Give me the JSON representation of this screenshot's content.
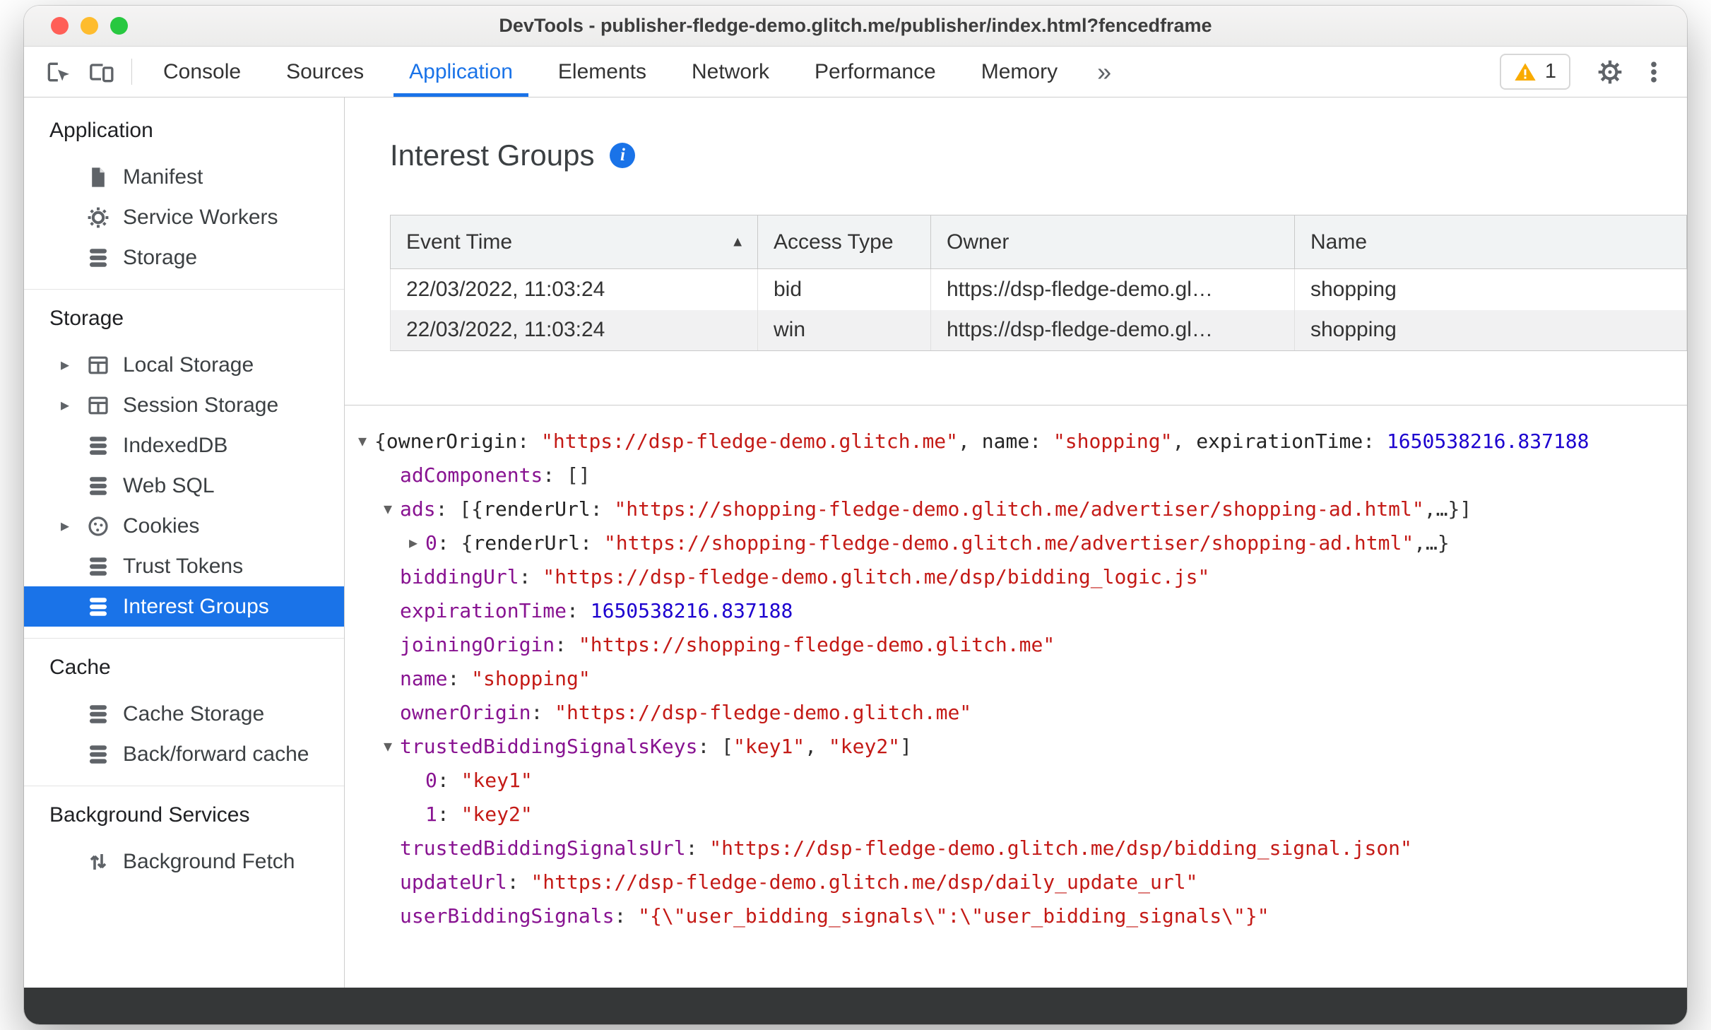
{
  "colors": {
    "accent": "#1a73e8",
    "key_purple": "#881391",
    "string_red": "#c41a16",
    "number_blue": "#1c00cf",
    "warning_yellow": "#f9ab00",
    "selected_bg": "#1a73e8"
  },
  "window": {
    "title": "DevTools - publisher-fledge-demo.glitch.me/publisher/index.html?fencedframe"
  },
  "toolbar": {
    "left_icons": [
      "inspect-icon",
      "device-toolbar-icon"
    ],
    "tabs": [
      "Console",
      "Sources",
      "Application",
      "Elements",
      "Network",
      "Performance",
      "Memory"
    ],
    "active_tab": "Application",
    "overflow_icon": "»",
    "warning_count": "1",
    "right_icons": [
      "settings-gear-icon",
      "more-options-icon"
    ]
  },
  "sidebar": {
    "sections": [
      {
        "title": "Application",
        "items": [
          {
            "label": "Manifest",
            "icon": "manifest-icon"
          },
          {
            "label": "Service Workers",
            "icon": "service-worker-icon"
          },
          {
            "label": "Storage",
            "icon": "database-icon"
          }
        ]
      },
      {
        "title": "Storage",
        "items": [
          {
            "label": "Local Storage",
            "icon": "table-icon",
            "expandable": true
          },
          {
            "label": "Session Storage",
            "icon": "table-icon",
            "expandable": true
          },
          {
            "label": "IndexedDB",
            "icon": "database-icon"
          },
          {
            "label": "Web SQL",
            "icon": "database-icon"
          },
          {
            "label": "Cookies",
            "icon": "cookie-icon",
            "expandable": true
          },
          {
            "label": "Trust Tokens",
            "icon": "database-icon"
          },
          {
            "label": "Interest Groups",
            "icon": "database-icon",
            "selected": true
          }
        ]
      },
      {
        "title": "Cache",
        "items": [
          {
            "label": "Cache Storage",
            "icon": "database-icon"
          },
          {
            "label": "Back/forward cache",
            "icon": "database-icon"
          }
        ]
      },
      {
        "title": "Background Services",
        "items": [
          {
            "label": "Background Fetch",
            "icon": "background-fetch-icon"
          }
        ]
      }
    ]
  },
  "main": {
    "title": "Interest Groups",
    "info_icon": "i",
    "table": {
      "columns": [
        "Event Time",
        "Access Type",
        "Owner",
        "Name"
      ],
      "sorted_column": "Event Time",
      "sort_direction": "asc",
      "rows": [
        [
          "22/03/2022, 11:03:24",
          "bid",
          "https://dsp-fledge-demo.gl…",
          "shopping"
        ],
        [
          "22/03/2022, 11:03:24",
          "win",
          "https://dsp-fledge-demo.gl…",
          "shopping"
        ]
      ]
    },
    "tree": {
      "lines": [
        {
          "indent": 0,
          "arrow": "down",
          "segments": [
            {
              "t": "plain",
              "x": "{"
            },
            {
              "t": "pkey",
              "x": "ownerOrigin"
            },
            {
              "t": "plain",
              "x": ": "
            },
            {
              "t": "str",
              "x": "\"https://dsp-fledge-demo.glitch.me\""
            },
            {
              "t": "plain",
              "x": ", "
            },
            {
              "t": "pkey",
              "x": "name"
            },
            {
              "t": "plain",
              "x": ": "
            },
            {
              "t": "str",
              "x": "\"shopping\""
            },
            {
              "t": "plain",
              "x": ", "
            },
            {
              "t": "pkey",
              "x": "expirationTime"
            },
            {
              "t": "plain",
              "x": ": "
            },
            {
              "t": "num",
              "x": "1650538216.837188"
            }
          ]
        },
        {
          "indent": 1,
          "arrow": "none",
          "segments": [
            {
              "t": "key",
              "x": "adComponents"
            },
            {
              "t": "plain",
              "x": ": "
            },
            {
              "t": "plain",
              "x": "[]"
            }
          ]
        },
        {
          "indent": 1,
          "arrow": "down",
          "segments": [
            {
              "t": "key",
              "x": "ads"
            },
            {
              "t": "plain",
              "x": ": "
            },
            {
              "t": "plain",
              "x": "[{"
            },
            {
              "t": "pkey",
              "x": "renderUrl"
            },
            {
              "t": "plain",
              "x": ": "
            },
            {
              "t": "str",
              "x": "\"https://shopping-fledge-demo.glitch.me/advertiser/shopping-ad.html\""
            },
            {
              "t": "plain",
              "x": ",…}]"
            }
          ]
        },
        {
          "indent": 2,
          "arrow": "right",
          "segments": [
            {
              "t": "index",
              "x": "0"
            },
            {
              "t": "plain",
              "x": ": {"
            },
            {
              "t": "pkey",
              "x": "renderUrl"
            },
            {
              "t": "plain",
              "x": ": "
            },
            {
              "t": "str",
              "x": "\"https://shopping-fledge-demo.glitch.me/advertiser/shopping-ad.html\""
            },
            {
              "t": "plain",
              "x": ",…}"
            }
          ]
        },
        {
          "indent": 1,
          "arrow": "none",
          "segments": [
            {
              "t": "key",
              "x": "biddingUrl"
            },
            {
              "t": "plain",
              "x": ": "
            },
            {
              "t": "str",
              "x": "\"https://dsp-fledge-demo.glitch.me/dsp/bidding_logic.js\""
            }
          ]
        },
        {
          "indent": 1,
          "arrow": "none",
          "segments": [
            {
              "t": "key",
              "x": "expirationTime"
            },
            {
              "t": "plain",
              "x": ": "
            },
            {
              "t": "num",
              "x": "1650538216.837188"
            }
          ]
        },
        {
          "indent": 1,
          "arrow": "none",
          "segments": [
            {
              "t": "key",
              "x": "joiningOrigin"
            },
            {
              "t": "plain",
              "x": ": "
            },
            {
              "t": "str",
              "x": "\"https://shopping-fledge-demo.glitch.me\""
            }
          ]
        },
        {
          "indent": 1,
          "arrow": "none",
          "segments": [
            {
              "t": "key",
              "x": "name"
            },
            {
              "t": "plain",
              "x": ": "
            },
            {
              "t": "str",
              "x": "\"shopping\""
            }
          ]
        },
        {
          "indent": 1,
          "arrow": "none",
          "segments": [
            {
              "t": "key",
              "x": "ownerOrigin"
            },
            {
              "t": "plain",
              "x": ": "
            },
            {
              "t": "str",
              "x": "\"https://dsp-fledge-demo.glitch.me\""
            }
          ]
        },
        {
          "indent": 1,
          "arrow": "down",
          "segments": [
            {
              "t": "key",
              "x": "trustedBiddingSignalsKeys"
            },
            {
              "t": "plain",
              "x": ": "
            },
            {
              "t": "plain",
              "x": "["
            },
            {
              "t": "str",
              "x": "\"key1\""
            },
            {
              "t": "plain",
              "x": ", "
            },
            {
              "t": "str",
              "x": "\"key2\""
            },
            {
              "t": "plain",
              "x": "]"
            }
          ]
        },
        {
          "indent": 2,
          "arrow": "none",
          "segments": [
            {
              "t": "index",
              "x": "0"
            },
            {
              "t": "plain",
              "x": ": "
            },
            {
              "t": "str",
              "x": "\"key1\""
            }
          ]
        },
        {
          "indent": 2,
          "arrow": "none",
          "segments": [
            {
              "t": "index",
              "x": "1"
            },
            {
              "t": "plain",
              "x": ": "
            },
            {
              "t": "str",
              "x": "\"key2\""
            }
          ]
        },
        {
          "indent": 1,
          "arrow": "none",
          "segments": [
            {
              "t": "key",
              "x": "trustedBiddingSignalsUrl"
            },
            {
              "t": "plain",
              "x": ": "
            },
            {
              "t": "str",
              "x": "\"https://dsp-fledge-demo.glitch.me/dsp/bidding_signal.json\""
            }
          ]
        },
        {
          "indent": 1,
          "arrow": "none",
          "segments": [
            {
              "t": "key",
              "x": "updateUrl"
            },
            {
              "t": "plain",
              "x": ": "
            },
            {
              "t": "str",
              "x": "\"https://dsp-fledge-demo.glitch.me/dsp/daily_update_url\""
            }
          ]
        },
        {
          "indent": 1,
          "arrow": "none",
          "segments": [
            {
              "t": "key",
              "x": "userBiddingSignals"
            },
            {
              "t": "plain",
              "x": ": "
            },
            {
              "t": "str",
              "x": "\"{\\\"user_bidding_signals\\\":\\\"user_bidding_signals\\\"}\""
            }
          ]
        }
      ]
    }
  }
}
